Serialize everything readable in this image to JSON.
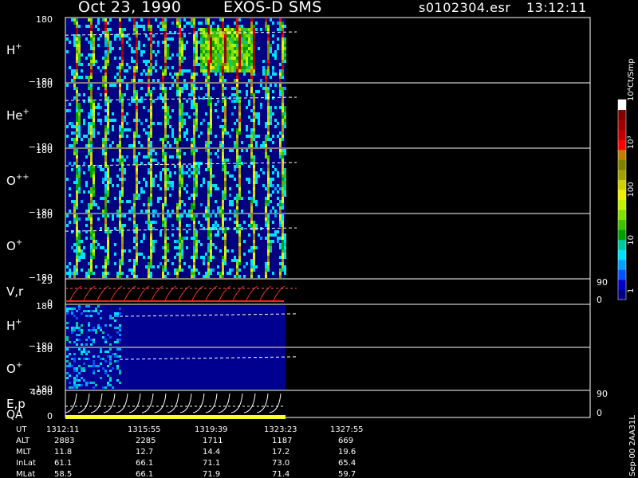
{
  "header": {
    "date": "Oct 23, 1990",
    "instrument": "EXOS-D SMS",
    "file": "s0102304.esr",
    "time": "13:12:11"
  },
  "side_label": "Sep-00 2AA31L",
  "colorbar": {
    "unit_label": "Ct/Smp",
    "tick_labels": [
      "1",
      "10",
      "100",
      "10³",
      "10⁴"
    ],
    "colors": [
      "#000080",
      "#0000c8",
      "#0050ff",
      "#00a0ff",
      "#00e0ff",
      "#00c8a0",
      "#00a000",
      "#40c000",
      "#80e000",
      "#c0f000",
      "#f0f000",
      "#d0d000",
      "#a0a000",
      "#808000",
      "#c08000",
      "#ff0000",
      "#c00000",
      "#a00000",
      "#800000",
      "#ffffff"
    ]
  },
  "panels": [
    {
      "label": "H",
      "sup": "+",
      "ytop": "180",
      "ybot": "−180"
    },
    {
      "label": "He",
      "sup": "+",
      "ytop": "180",
      "ybot": "−180"
    },
    {
      "label": "O",
      "sup": "++",
      "ytop": "180",
      "ybot": "−180"
    },
    {
      "label": "O",
      "sup": "+",
      "ytop": "180",
      "ybot": "−180"
    },
    {
      "label": "V,r",
      "sup": "",
      "ytop": "25",
      "ybot": "0",
      "right_top": "90",
      "right_bot": "0"
    },
    {
      "label": "H",
      "sup": "+",
      "ytop": "180",
      "ybot": "−180"
    },
    {
      "label": "O",
      "sup": "+",
      "ytop": "180",
      "ybot": "−180"
    },
    {
      "label": "E,p",
      "sup": "",
      "label2": "QA",
      "ytop": "4000",
      "ybot": "0",
      "right_top": "90",
      "right_bot": "0"
    }
  ],
  "footer": {
    "rows": [
      {
        "label": "UT",
        "values": [
          "1312:11",
          "1315:55",
          "1319:39",
          "1323:23",
          "1327:55"
        ]
      },
      {
        "label": "ALT",
        "values": [
          "2883",
          "2285",
          "1711",
          "1187",
          "669"
        ]
      },
      {
        "label": "MLT",
        "values": [
          "11.8",
          "12.7",
          "14.4",
          "17.2",
          "19.6"
        ]
      },
      {
        "label": "InLat",
        "values": [
          "61.1",
          "66.1",
          "71.1",
          "73.0",
          "65.4"
        ]
      },
      {
        "label": "MLat",
        "values": [
          "58.5",
          "66.1",
          "71.9",
          "71.4",
          "59.7"
        ]
      }
    ]
  },
  "chart_data": {
    "type": "heatmap",
    "title": "Oct 23, 1990 EXOS-D SMS",
    "x_axis": {
      "label": "UT",
      "tick_labels": [
        "1312:11",
        "1315:55",
        "1319:39",
        "1323:23",
        "1327:55"
      ]
    },
    "data_coverage_end_tick": "1323:23",
    "series": [
      {
        "name": "H+",
        "yrange": [
          -180,
          180
        ],
        "spin_cycles": 15
      },
      {
        "name": "He+",
        "yrange": [
          -180,
          180
        ],
        "spin_cycles": 15
      },
      {
        "name": "O++",
        "yrange": [
          -180,
          180
        ],
        "spin_cycles": 15
      },
      {
        "name": "O+",
        "yrange": [
          -180,
          180
        ],
        "spin_cycles": 15
      },
      {
        "name": "V,r",
        "yrange": [
          0,
          25
        ],
        "right_range": [
          0,
          90
        ]
      },
      {
        "name": "H+",
        "yrange": [
          -180,
          180
        ]
      },
      {
        "name": "O+",
        "yrange": [
          -180,
          180
        ]
      },
      {
        "name": "E,p",
        "yrange": [
          0,
          4000
        ],
        "right_range": [
          0,
          90
        ]
      }
    ],
    "colorbar_range": [
      1,
      10000
    ],
    "colorbar_scale": "log"
  }
}
